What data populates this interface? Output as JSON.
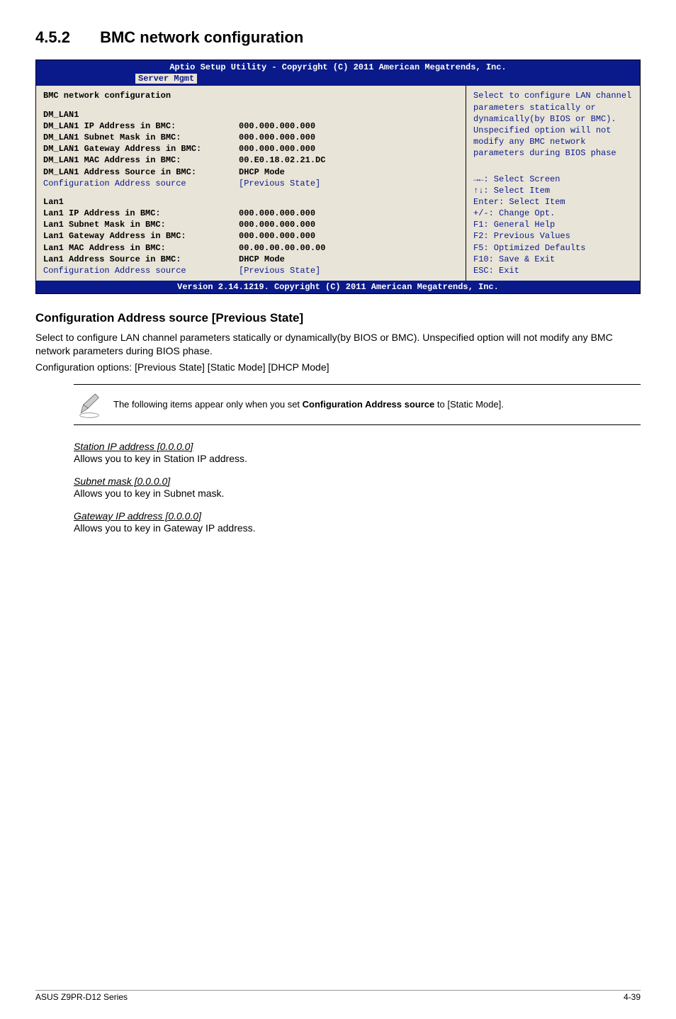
{
  "section": {
    "number": "4.5.2",
    "title": "BMC network configuration"
  },
  "bios": {
    "header": "Aptio Setup Utility - Copyright (C) 2011 American Megatrends, Inc.",
    "tab": "Server Mgmt",
    "left": {
      "title": "BMC network configuration",
      "dm_header": "DM_LAN1",
      "dm_rows": [
        {
          "label": "DM_LAN1 IP Address in BMC:",
          "value": "000.000.000.000"
        },
        {
          "label": "DM_LAN1 Subnet Mask in BMC:",
          "value": "000.000.000.000"
        },
        {
          "label": "DM_LAN1 Gateway Address in BMC:",
          "value": "000.000.000.000"
        },
        {
          "label": "DM_LAN1 MAC Address in BMC:",
          "value": "00.E0.18.02.21.DC"
        },
        {
          "label": "DM_LAN1 Address Source in BMC:",
          "value": "DHCP Mode"
        }
      ],
      "dm_config_label": "Configuration Address source",
      "dm_config_value": "[Previous State]",
      "lan_header": "Lan1",
      "lan_rows": [
        {
          "label": "Lan1 IP Address in BMC:",
          "value": "000.000.000.000"
        },
        {
          "label": "Lan1 Subnet Mask in BMC:",
          "value": "000.000.000.000"
        },
        {
          "label": "Lan1 Gateway Address in BMC:",
          "value": "000.000.000.000"
        },
        {
          "label": "Lan1 MAC Address in BMC:",
          "value": "00.00.00.00.00.00"
        },
        {
          "label": "Lan1 Address Source in BMC:",
          "value": "DHCP Mode"
        }
      ],
      "lan_config_label": "Configuration Address source",
      "lan_config_value": "[Previous State]"
    },
    "right": {
      "help1": "Select to configure LAN channel parameters statically or dynamically(by BIOS or BMC). Unspecified option will not modify any BMC network parameters during BIOS phase",
      "keys": [
        "→←: Select Screen",
        "↑↓:  Select Item",
        "Enter: Select Item",
        "+/-: Change Opt.",
        "F1: General Help",
        "F2: Previous Values",
        "F5: Optimized Defaults",
        "F10: Save & Exit",
        "ESC: Exit"
      ]
    },
    "footer": "Version 2.14.1219. Copyright (C) 2011 American Megatrends, Inc."
  },
  "doc": {
    "h3": "Configuration Address source [Previous State]",
    "p1": "Select to configure LAN channel parameters statically or dynamically(by BIOS or BMC). Unspecified option will not modify any BMC network parameters during BIOS phase.",
    "p2": "Configuration options: [Previous State] [Static Mode] [DHCP Mode]",
    "note_pre": "The following items appear only when you set ",
    "note_bold": "Configuration Address source",
    "note_post": " to [Static Mode].",
    "items": [
      {
        "head": "Station IP address [0.0.0.0]",
        "body": "Allows you to key in Station IP address."
      },
      {
        "head": "Subnet mask [0.0.0.0]",
        "body": "Allows you to key in Subnet mask."
      },
      {
        "head": "Gateway IP address [0.0.0.0]",
        "body": "Allows you to key in Gateway IP address."
      }
    ]
  },
  "footer": {
    "left": "ASUS Z9PR-D12 Series",
    "right": "4-39"
  }
}
